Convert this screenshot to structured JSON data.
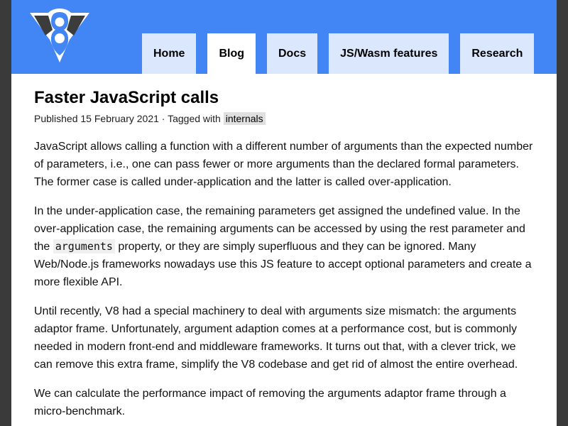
{
  "site": {
    "logo_icon": "v8-logo-icon",
    "brand_color": "#4285f4"
  },
  "nav": {
    "items": [
      {
        "label": "Home"
      },
      {
        "label": "Blog"
      },
      {
        "label": "Docs"
      },
      {
        "label": "JS/Wasm features"
      },
      {
        "label": "Research"
      }
    ],
    "active": "Blog"
  },
  "article": {
    "title": "Faster JavaScript calls",
    "published_prefix": "Published ",
    "date": "15 February 2021",
    "tagged_prefix": " · Tagged with ",
    "tag": "internals",
    "p1": "JavaScript allows calling a function with a different number of arguments than the expected number of parameters, i.e., one can pass fewer or more arguments than the declared formal parameters. The former case is called under-application and the latter is called over-application.",
    "p2_a": "In the under-application case, the remaining parameters get assigned the undefined value. In the over-application case, the remaining arguments can be accessed by using the rest parameter and the ",
    "p2_code": "arguments",
    "p2_b": " property, or they are simply superfluous and they can be ignored. Many Web/Node.js frameworks nowadays use this JS feature to accept optional parameters and create a more flexible API.",
    "p3": "Until recently, V8 had a special machinery to deal with arguments size mismatch: the arguments adaptor frame. Unfortunately, argument adaption comes at a performance cost, but is commonly needed in modern front-end and middleware frameworks. It turns out that, with a clever trick, we can remove this extra frame, simplify the V8 codebase and get rid of almost the entire overhead.",
    "p4": "We can calculate the performance impact of removing the arguments adaptor frame through a micro-benchmark."
  }
}
